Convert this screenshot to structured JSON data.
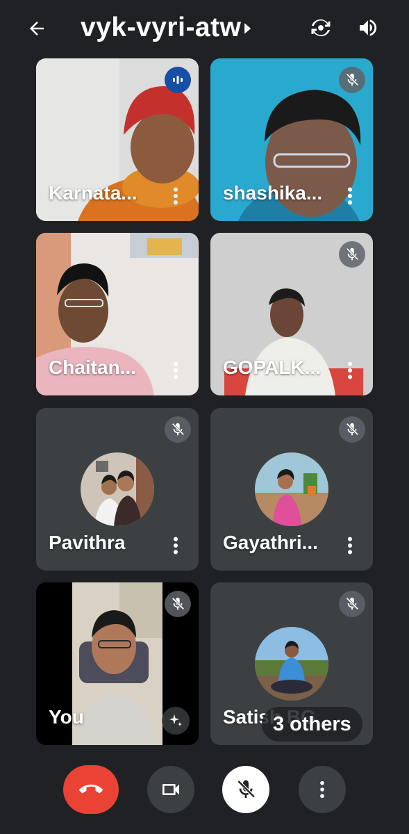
{
  "header": {
    "meeting_code": "vyk-vyri-atw",
    "back_icon": "arrow-back-icon",
    "switch_camera_icon": "switch-camera-icon",
    "audio_icon": "speaker-icon"
  },
  "participants": [
    {
      "name": "Karnata...",
      "state": "talking"
    },
    {
      "name": "shashika...",
      "state": "muted"
    },
    {
      "name": "Chaitan...",
      "state": "unmuted"
    },
    {
      "name": "GOPALK...",
      "state": "muted"
    },
    {
      "name": "Pavithra",
      "state": "muted"
    },
    {
      "name": "Gayathri...",
      "state": "muted"
    },
    {
      "name": "You",
      "state": "muted"
    },
    {
      "name": "Satish BG",
      "state": "muted"
    }
  ],
  "overflow": {
    "others_label": "3 others"
  },
  "controls": {
    "end_call_icon": "end-call-icon",
    "camera_icon": "video-camera-icon",
    "mic_icon": "mic-off-icon",
    "more_icon": "more-vert-icon"
  },
  "colors": {
    "background": "#202124",
    "end_call": "#ea4335",
    "talking": "#174ea6",
    "tile": "#3c4043"
  }
}
